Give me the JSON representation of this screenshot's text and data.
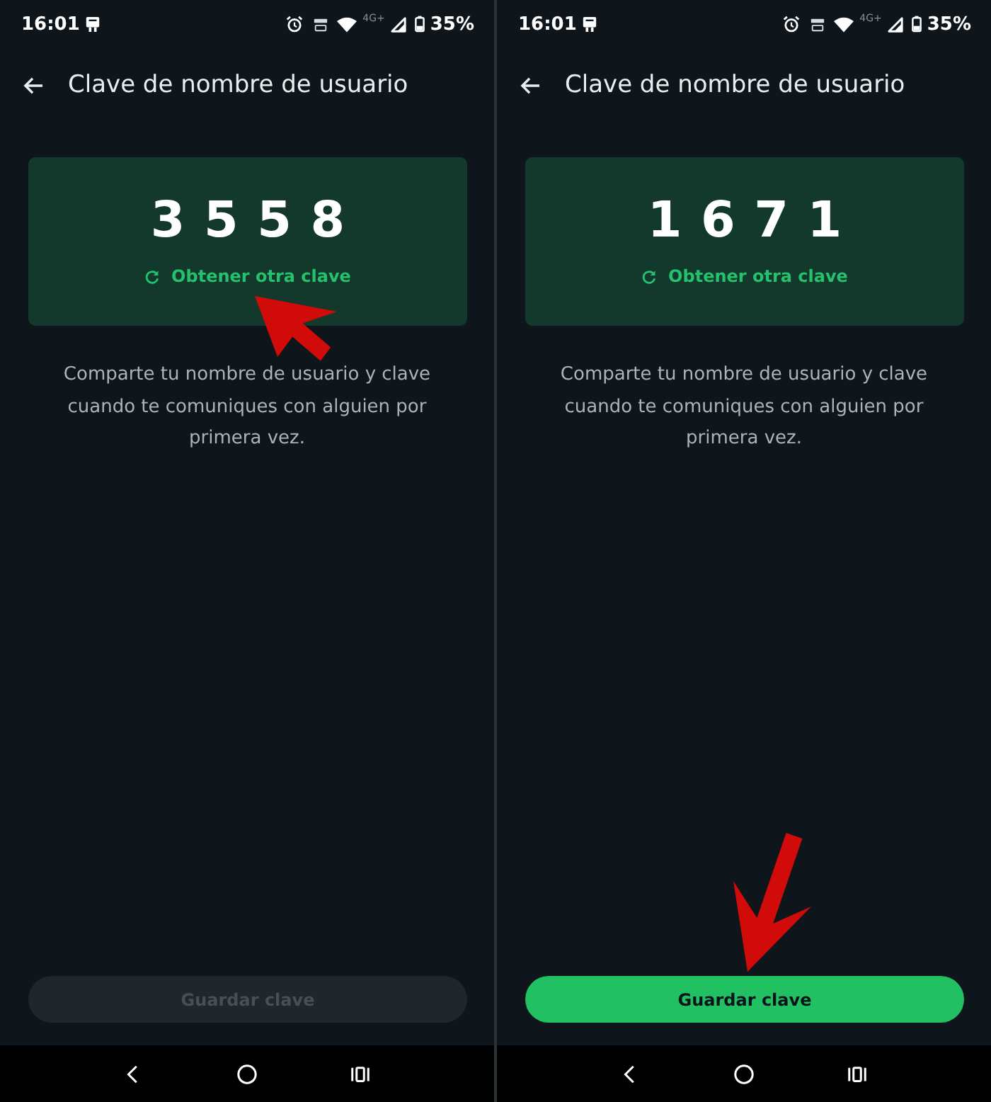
{
  "screens": [
    {
      "status_bar": {
        "time": "16:01",
        "network_type": "4G+",
        "battery": "35%"
      },
      "header": {
        "title": "Clave de nombre de usuario"
      },
      "code_card": {
        "code": "3558",
        "link": "Obtener otra clave",
        "arrow_marked": true
      },
      "description": "Comparte tu nombre de usuario y clave cuando te comuniques con alguien por primera vez.",
      "save_button": {
        "label": "Guardar clave",
        "disabled": true,
        "arrow_marked": false
      }
    },
    {
      "status_bar": {
        "time": "16:01",
        "network_type": "4G+",
        "battery": "35%"
      },
      "header": {
        "title": "Clave de nombre de usuario"
      },
      "code_card": {
        "code": "1671",
        "link": "Obtener otra clave",
        "arrow_marked": false
      },
      "description": "Comparte tu nombre de usuario y clave cuando te comuniques con alguien por primera vez.",
      "save_button": {
        "label": "Guardar clave",
        "disabled": false,
        "arrow_marked": true
      }
    }
  ]
}
